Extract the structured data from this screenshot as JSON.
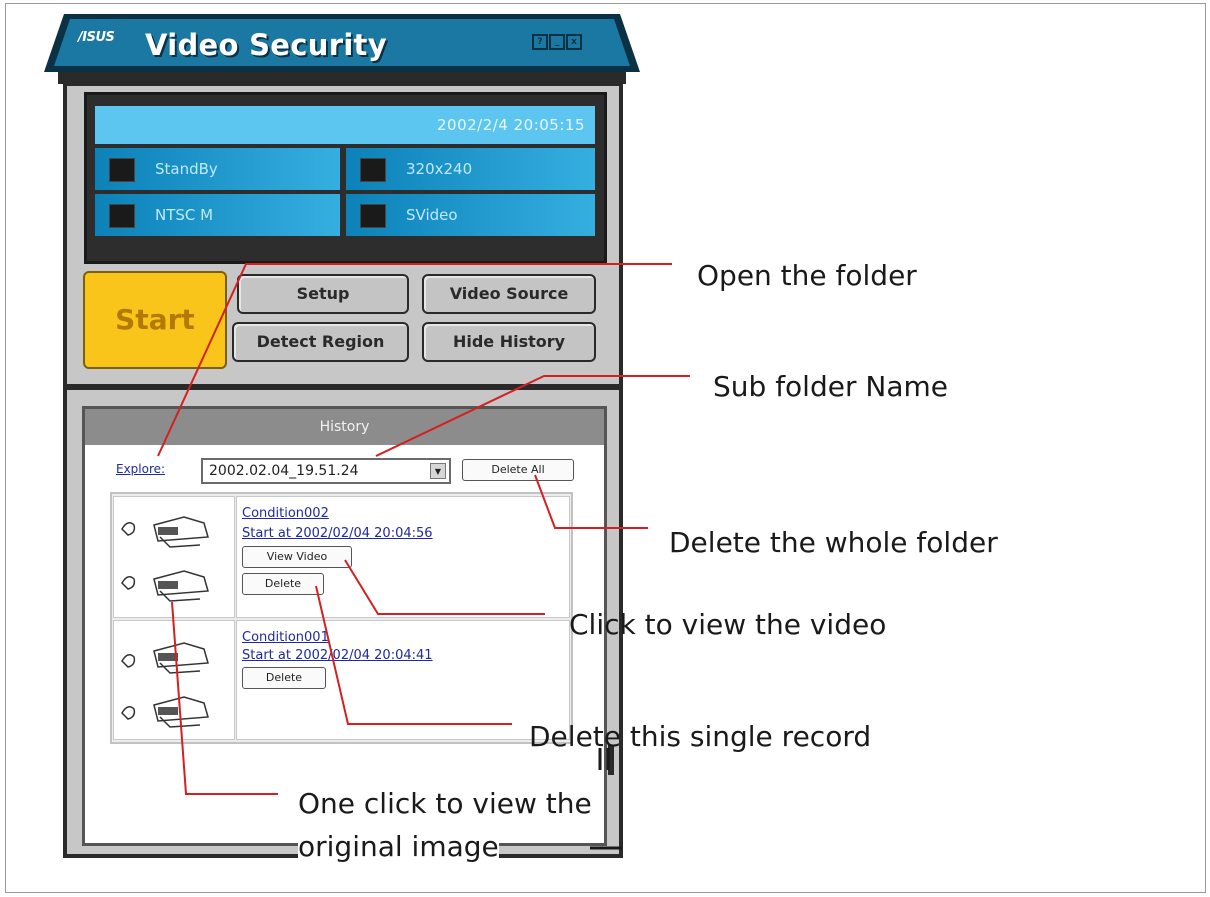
{
  "window": {
    "logo": "/ISUS",
    "title": "Video Security",
    "buttons": [
      "?",
      "_",
      "x"
    ]
  },
  "status": {
    "datetime": "2002/2/4     20:05:15",
    "mode": "StandBy",
    "resolution": "320x240",
    "standard": "NTSC M",
    "input": "SVideo"
  },
  "controls": {
    "start": "Start",
    "setup": "Setup",
    "video_source": "Video Source",
    "detect_region": "Detect Region",
    "hide_history": "Hide History"
  },
  "history": {
    "heading": "History",
    "explore": "Explore:",
    "folder": "2002.02.04_19.51.24",
    "delete_all": "Delete All",
    "records": [
      {
        "name": "Condition002",
        "start": "Start at 2002/02/04 20:04:56",
        "view_video": "View Video",
        "delete": "Delete"
      },
      {
        "name": "Condition001",
        "start": "Start at 2002/02/04 20:04:41",
        "delete": "Delete"
      }
    ]
  },
  "annotations": {
    "open_folder": "Open the folder",
    "sub_folder": "Sub folder Name",
    "delete_folder": "Delete the whole folder",
    "view_video": "Click to view the video",
    "delete_record": "Delete this single record",
    "view_image_1": "One click to view the",
    "view_image_2": "original image"
  },
  "colors": {
    "titlebar": "#1a78a3",
    "lcd": "#0c82b8",
    "start": "#f9c51a",
    "annotation_line": "#d42020"
  }
}
